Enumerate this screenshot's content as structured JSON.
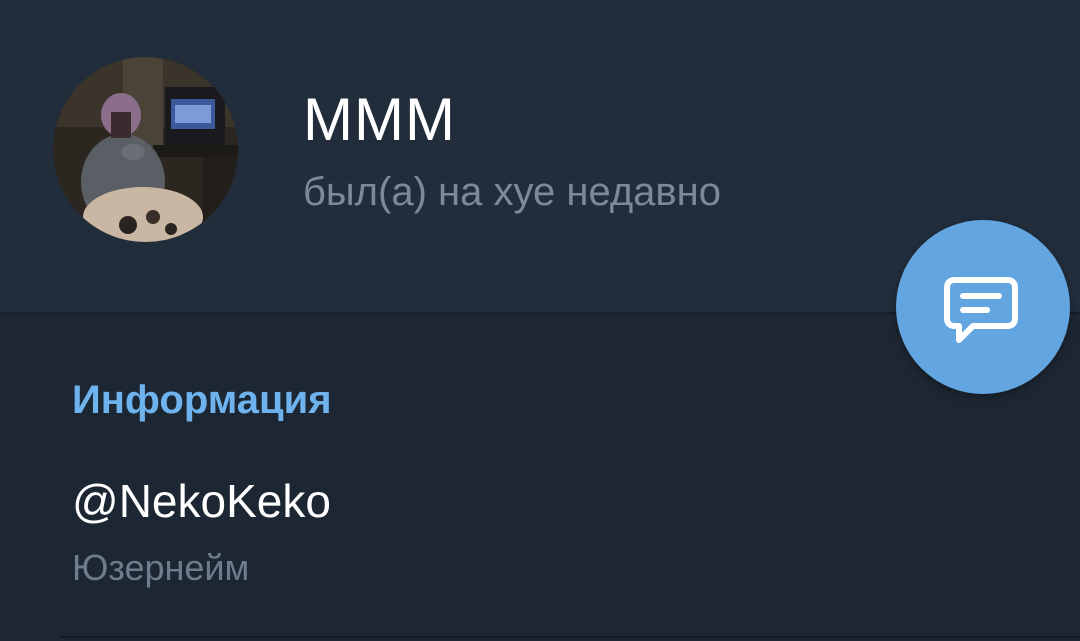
{
  "profile": {
    "name": "МММ",
    "status": "был(а) на хуе недавно"
  },
  "fab": {
    "icon": "message-icon",
    "color": "#62a5e0"
  },
  "info": {
    "section_title": "Информация",
    "username": "@NekoKeko",
    "username_label": "Юзернейм"
  },
  "colors": {
    "header_bg": "#212d3b",
    "body_bg": "#1d2733",
    "accent": "#6fb3ee"
  }
}
